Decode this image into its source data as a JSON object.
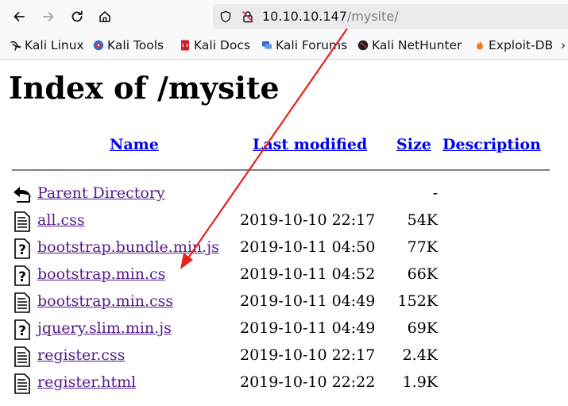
{
  "browser": {
    "url_host": "10.10.10.147",
    "url_path": "/mysite/"
  },
  "bookmarks": [
    {
      "label": "Kali Linux",
      "icon": "kali-dragon-icon"
    },
    {
      "label": "Kali Tools",
      "icon": "kali-tools-icon"
    },
    {
      "label": "Kali Docs",
      "icon": "kali-docs-icon"
    },
    {
      "label": "Kali Forums",
      "icon": "kali-forums-icon"
    },
    {
      "label": "Kali NetHunter",
      "icon": "kali-nethunter-icon"
    },
    {
      "label": "Exploit-DB",
      "icon": "exploit-db-icon"
    }
  ],
  "page": {
    "title": "Index of /mysite",
    "columns": {
      "name": "Name",
      "modified": "Last modified",
      "size": "Size",
      "description": "Description"
    },
    "rows": [
      {
        "name": "Parent Directory",
        "date": "",
        "size": "-",
        "icon": "back-arrow-icon"
      },
      {
        "name": "all.css",
        "date": "2019-10-10 22:17",
        "size": "54K",
        "icon": "text-file-icon"
      },
      {
        "name": "bootstrap.bundle.min.js",
        "date": "2019-10-11 04:50",
        "size": "77K",
        "icon": "unknown-file-icon"
      },
      {
        "name": "bootstrap.min.cs",
        "date": "2019-10-11 04:52",
        "size": "66K",
        "icon": "unknown-file-icon"
      },
      {
        "name": "bootstrap.min.css",
        "date": "2019-10-11 04:49",
        "size": "152K",
        "icon": "text-file-icon"
      },
      {
        "name": "jquery.slim.min.js",
        "date": "2019-10-11 04:49",
        "size": "69K",
        "icon": "unknown-file-icon"
      },
      {
        "name": "register.css",
        "date": "2019-10-10 22:17",
        "size": "2.4K",
        "icon": "text-file-icon"
      },
      {
        "name": "register.html",
        "date": "2019-10-10 22:22",
        "size": "1.9K",
        "icon": "text-file-icon"
      }
    ]
  },
  "annotation": {
    "arrow_color": "#e8211e"
  }
}
